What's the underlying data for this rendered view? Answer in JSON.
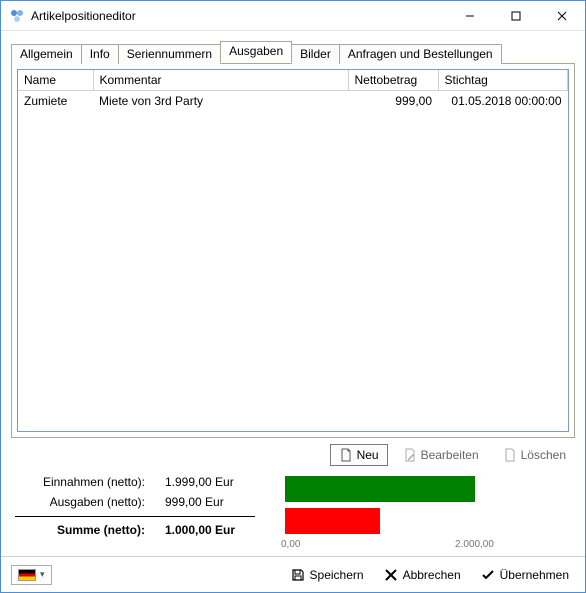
{
  "window": {
    "title": "Artikelpositioneditor"
  },
  "tabs": {
    "items": [
      {
        "label": "Allgemein"
      },
      {
        "label": "Info"
      },
      {
        "label": "Seriennummern"
      },
      {
        "label": "Ausgaben"
      },
      {
        "label": "Bilder"
      },
      {
        "label": "Anfragen und Bestellungen"
      }
    ],
    "active_index": 3
  },
  "grid": {
    "headers": {
      "name": "Name",
      "kommentar": "Kommentar",
      "nettobetrag": "Nettobetrag",
      "stichtag": "Stichtag"
    },
    "rows": [
      {
        "name": "Zumiete",
        "kommentar": "Miete von 3rd Party",
        "nettobetrag": "999,00",
        "stichtag": "01.05.2018 00:00:00"
      }
    ]
  },
  "row_actions": {
    "neu": "Neu",
    "bearbeiten": "Bearbeiten",
    "loeschen": "Löschen"
  },
  "totals": {
    "einnahmen_label": "Einnahmen (netto):",
    "einnahmen_value": "1.999,00 Eur",
    "ausgaben_label": "Ausgaben (netto):",
    "ausgaben_value": "999,00 Eur",
    "summe_label": "Summe (netto):",
    "summe_value": "1.000,00 Eur"
  },
  "chart_data": {
    "type": "bar",
    "orientation": "horizontal",
    "categories": [
      "Einnahmen",
      "Ausgaben"
    ],
    "values": [
      1999.0,
      999.0
    ],
    "colors": [
      "#008000",
      "#ff0000"
    ],
    "xlim": [
      0,
      2000
    ],
    "xticks": [
      0.0,
      2000.0
    ],
    "xtick_labels": [
      "0,00",
      "2.000,00"
    ],
    "title": "",
    "xlabel": "",
    "ylabel": ""
  },
  "footer": {
    "speichern": "Speichern",
    "abbrechen": "Abbrechen",
    "uebernehmen": "Übernehmen"
  }
}
